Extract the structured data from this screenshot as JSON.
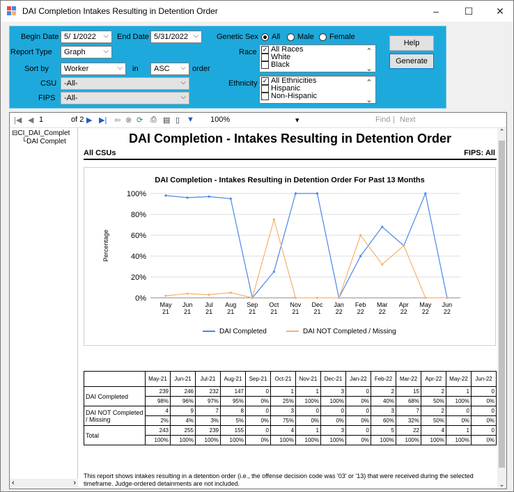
{
  "window": {
    "title": "DAI Completion Intakes Resulting in Detention Order",
    "minimize": "–",
    "maximize": "☐",
    "close": "✕"
  },
  "params": {
    "begin_date_label": "Begin Date",
    "begin_date": "5/ 1/2022",
    "end_date_label": "End Date",
    "end_date": "5/31/2022",
    "report_type_label": "Report Type",
    "report_type": "Graph",
    "sort_by_label": "Sort by",
    "sort_by": "Worker",
    "in_label": "in",
    "order": "ASC",
    "order_label": "order",
    "csu_label": "CSU",
    "csu": "-All-",
    "fips_label": "FIPS",
    "fips": "-All-",
    "sex_label": "Genetic Sex",
    "sex_options": [
      "All",
      "Male",
      "Female"
    ],
    "race_label": "Race",
    "race_options": [
      "All Races",
      "White",
      "Black"
    ],
    "ethnicity_label": "Ethnicity",
    "ethnicity_options": [
      "All Ethnicities",
      "Hispanic",
      "Non-Hispanic"
    ],
    "help": "Help",
    "generate": "Generate"
  },
  "toolbar": {
    "page": "1",
    "of": "of 2",
    "zoom": "100%",
    "find": "Find",
    "sep": "|",
    "next": "Next"
  },
  "tree": {
    "root": "CI_DAI_Complet",
    "child": "DAI Complet"
  },
  "report": {
    "title": "DAI Completion - Intakes Resulting in Detention Order",
    "csus": "All CSUs",
    "fips": "FIPS: All",
    "footer": "This report shows intakes resulting in a detention order (i.e., the offense decision code was '03' or '13) that were received during the selected timeframe. Judge-ordered detainments are not included."
  },
  "chart_data": {
    "type": "line",
    "title": "DAI Completion - Intakes Resulting in Detention Order For Past 13 Months",
    "categories": [
      "May 21",
      "Jun 21",
      "Jul 21",
      "Aug 21",
      "Sep 21",
      "Oct 21",
      "Nov 21",
      "Dec 21",
      "Jan 22",
      "Feb 22",
      "Mar 22",
      "Apr 22",
      "May 22",
      "Jun 22"
    ],
    "ylabel": "Percentage",
    "ylim": [
      0,
      100
    ],
    "yticks": [
      "0%",
      "20%",
      "40%",
      "60%",
      "80%",
      "100%"
    ],
    "series": [
      {
        "name": "DAI Completed",
        "color": "#4a86e8",
        "values": [
          98,
          96,
          97,
          95,
          0,
          25,
          100,
          100,
          0,
          40,
          68,
          50,
          100,
          0
        ]
      },
      {
        "name": "DAI NOT Completed / Missing",
        "color": "#f6b26b",
        "values": [
          2,
          4,
          3,
          5,
          0,
          75,
          0,
          0,
          0,
          60,
          32,
          50,
          0,
          0
        ]
      }
    ],
    "legend": "bottom"
  },
  "table": {
    "headers": [
      "May-21",
      "Jun-21",
      "Jul-21",
      "Aug-21",
      "Sep-21",
      "Oct-21",
      "Nov-21",
      "Dec-21",
      "Jan-22",
      "Feb-22",
      "Mar-22",
      "Apr-22",
      "May-22",
      "Jun-22"
    ],
    "rows": [
      {
        "label": "DAI Completed",
        "counts": [
          "239",
          "246",
          "232",
          "147",
          "0",
          "1",
          "1",
          "3",
          "0",
          "2",
          "15",
          "2",
          "1",
          "0"
        ],
        "pcts": [
          "98%",
          "96%",
          "97%",
          "95%",
          "0%",
          "25%",
          "100%",
          "100%",
          "0%",
          "40%",
          "68%",
          "50%",
          "100%",
          "0%"
        ]
      },
      {
        "label": "DAI NOT Completed / Missing",
        "counts": [
          "4",
          "9",
          "7",
          "8",
          "0",
          "3",
          "0",
          "0",
          "0",
          "3",
          "7",
          "2",
          "0",
          "0"
        ],
        "pcts": [
          "2%",
          "4%",
          "3%",
          "5%",
          "0%",
          "75%",
          "0%",
          "0%",
          "0%",
          "60%",
          "32%",
          "50%",
          "0%",
          "0%"
        ]
      },
      {
        "label": "Total",
        "counts": [
          "243",
          "255",
          "239",
          "155",
          "0",
          "4",
          "1",
          "3",
          "0",
          "5",
          "22",
          "4",
          "1",
          "0"
        ],
        "pcts": [
          "100%",
          "100%",
          "100%",
          "100%",
          "0%",
          "100%",
          "100%",
          "100%",
          "0%",
          "100%",
          "100%",
          "100%",
          "100%",
          "0%"
        ]
      }
    ]
  }
}
